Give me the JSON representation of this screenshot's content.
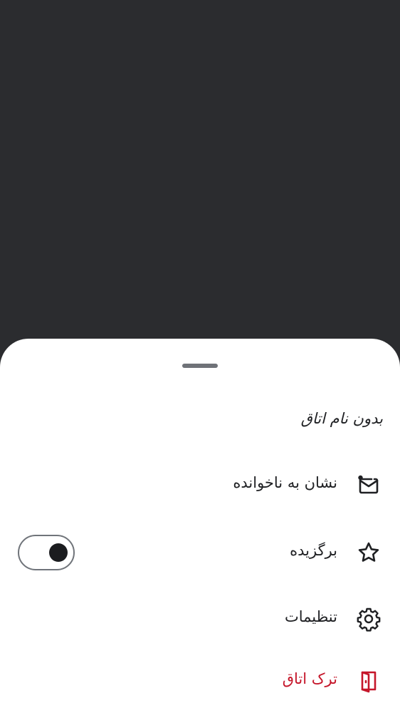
{
  "room_sheet": {
    "title": "بدون نام اتاق",
    "items": [
      {
        "label": "نشان به ناخوانده",
        "icon": "mark-unread-icon"
      },
      {
        "label": "برگزیده",
        "icon": "star-icon",
        "toggle_on": true
      },
      {
        "label": "تنظیمات",
        "icon": "settings-gear-icon"
      },
      {
        "label": "ترک اتاق",
        "icon": "leave-door-icon",
        "color": "#c5162a"
      }
    ]
  },
  "colors": {
    "backdrop": "#2b2c2f",
    "sheet": "#ffffff",
    "text": "#1f2023",
    "danger": "#c5162a",
    "handle": "#6f7278"
  }
}
